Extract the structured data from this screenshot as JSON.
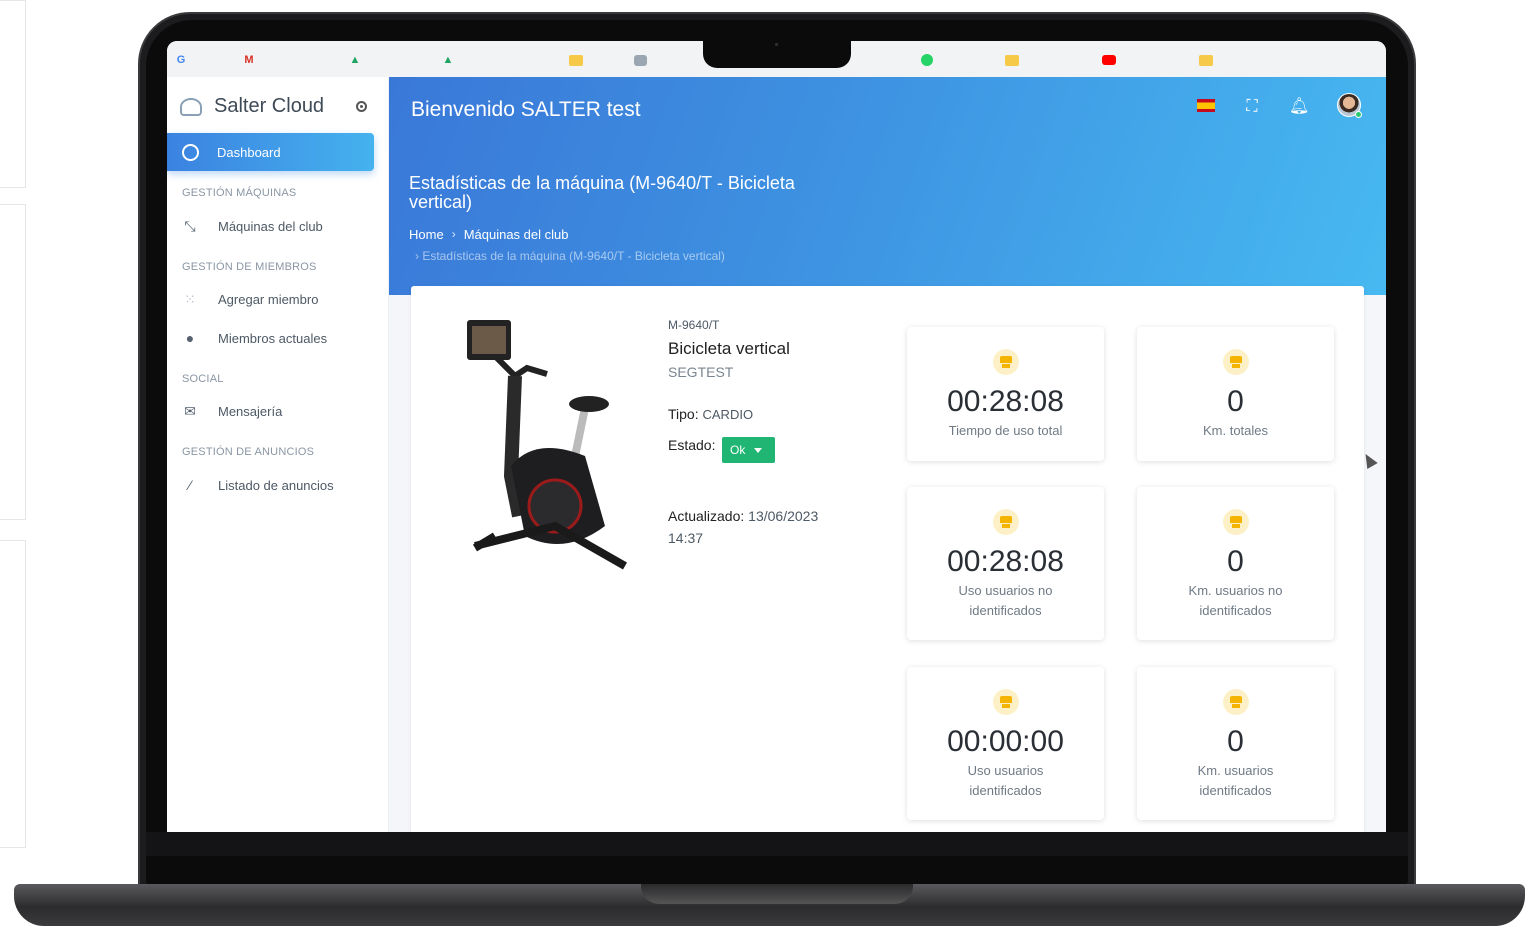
{
  "colors": {
    "accent": "#3b82e0",
    "header_gradient_end": "#47b9f1",
    "status_ok": "#21b573",
    "stat_icon": "#f5b400"
  },
  "bookmarks": [
    "G",
    "M",
    "drive-icon",
    "drive-icon",
    "folder-icon",
    "app-icon",
    "whatsapp-icon",
    "folder-icon",
    "youtube-icon",
    "folder-icon"
  ],
  "sidebar": {
    "brand": "Salter Cloud",
    "active": {
      "label": "Dashboard",
      "icon": "dashboard-icon"
    },
    "sections": [
      {
        "title": "GESTIÓN MÁQUINAS",
        "items": [
          {
            "label": "Máquinas del club",
            "icon": "arrows-icon"
          }
        ]
      },
      {
        "title": "GESTIÓN DE MIEMBROS",
        "items": [
          {
            "label": "Agregar miembro",
            "icon": "grid-icon"
          },
          {
            "label": "Miembros actuales",
            "icon": "user-circle-icon"
          }
        ]
      },
      {
        "title": "SOCIAL",
        "items": [
          {
            "label": "Mensajería",
            "icon": "mail-icon"
          }
        ]
      },
      {
        "title": "GESTIÓN DE ANUNCIOS",
        "items": [
          {
            "label": "Listado de anuncios",
            "icon": "megaphone-icon"
          }
        ]
      }
    ]
  },
  "header": {
    "title": "Bienvenido SALTER test",
    "page_heading": "Estadísticas de la máquina (M-9640/T - Bicicleta vertical)",
    "breadcrumb": [
      "Home",
      "Máquinas del club"
    ],
    "breadcrumb_current": "Estadísticas de la máquina (M-9640/T - Bicicleta vertical)",
    "icons": [
      "spain-flag-icon",
      "fullscreen-icon",
      "bell-icon",
      "avatar"
    ]
  },
  "machine": {
    "code": "M-9640/T",
    "name": "Bicicleta vertical",
    "club": "SEGTEST",
    "tipo_label": "Tipo:",
    "tipo_value": "CARDIO",
    "estado_label": "Estado:",
    "estado_value": "Ok",
    "updated_label": "Actualizado:",
    "updated_value": "13/06/2023 14:37"
  },
  "stats": [
    {
      "value": "00:28:08",
      "label": "Tiempo de uso total"
    },
    {
      "value": "0",
      "label": "Km. totales"
    },
    {
      "value": "00:28:08",
      "label": "Uso usuarios no identificados"
    },
    {
      "value": "0",
      "label": "Km. usuarios no identificados"
    },
    {
      "value": "00:00:00",
      "label": "Uso usuarios identificados"
    },
    {
      "value": "0",
      "label": "Km. usuarios identificados"
    }
  ]
}
